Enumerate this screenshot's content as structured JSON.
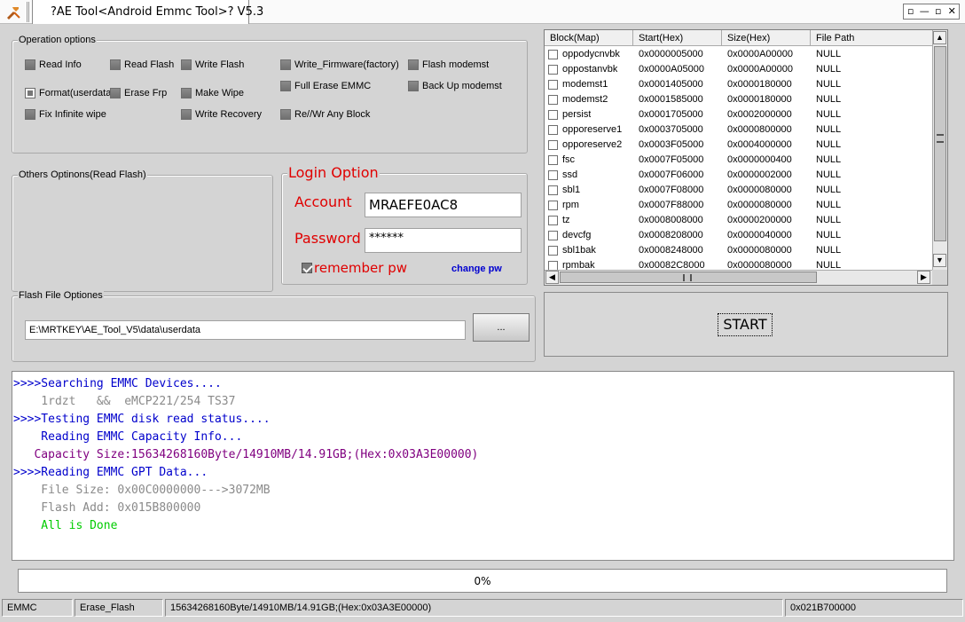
{
  "window": {
    "title": "?AE Tool<Android Emmc Tool>? V5.3",
    "controls": [
      "▫",
      "—",
      "▫",
      "✕"
    ]
  },
  "operation": {
    "title": "Operation options",
    "items": [
      {
        "label": "Read Info",
        "state": "off"
      },
      {
        "label": "Read Flash",
        "state": "off"
      },
      {
        "label": "Write Flash",
        "state": "off"
      },
      {
        "label": "Write_Firmware(factory)",
        "state": "off"
      },
      {
        "label": "Flash modemst",
        "state": "off"
      },
      {
        "label": "Format(userdata)",
        "state": "selected"
      },
      {
        "label": "Erase Frp",
        "state": "off"
      },
      {
        "label": "Make Wipe",
        "state": "off"
      },
      {
        "label": "Full Erase EMMC",
        "state": "off"
      },
      {
        "label": "Back Up modemst",
        "state": "off"
      },
      {
        "label": "Fix Infinite wipe",
        "state": "off"
      },
      {
        "label": "Write Recovery",
        "state": "off"
      },
      {
        "label": "Re//Wr Any Block",
        "state": "off"
      }
    ]
  },
  "others": {
    "title": "Others Optinons(Read Flash)"
  },
  "login": {
    "title": "Login Option",
    "account_label": "Account",
    "account_value": "MRAEFE0AC8",
    "password_label": "Password",
    "password_value": "******",
    "remember_label": "remember pw",
    "remember_checked": true,
    "change_label": "change pw"
  },
  "flash": {
    "title": "Flash File Optiones",
    "path": "E:\\MRTKEY\\AE_Tool_V5\\data\\userdata",
    "browse_label": "..."
  },
  "blocks": {
    "columns": [
      "Block(Map)",
      "Start(Hex)",
      "Size(Hex)",
      "File Path"
    ],
    "rows": [
      [
        "oppodycnvbk",
        "0x0000005000",
        "0x0000A00000",
        "NULL"
      ],
      [
        "oppostanvbk",
        "0x0000A05000",
        "0x0000A00000",
        "NULL"
      ],
      [
        "modemst1",
        "0x0001405000",
        "0x0000180000",
        "NULL"
      ],
      [
        "modemst2",
        "0x0001585000",
        "0x0000180000",
        "NULL"
      ],
      [
        "persist",
        "0x0001705000",
        "0x0002000000",
        "NULL"
      ],
      [
        "opporeserve1",
        "0x0003705000",
        "0x0000800000",
        "NULL"
      ],
      [
        "opporeserve2",
        "0x0003F05000",
        "0x0004000000",
        "NULL"
      ],
      [
        "fsc",
        "0x0007F05000",
        "0x0000000400",
        "NULL"
      ],
      [
        "ssd",
        "0x0007F06000",
        "0x0000002000",
        "NULL"
      ],
      [
        "sbl1",
        "0x0007F08000",
        "0x0000080000",
        "NULL"
      ],
      [
        "rpm",
        "0x0007F88000",
        "0x0000080000",
        "NULL"
      ],
      [
        "tz",
        "0x0008008000",
        "0x0000200000",
        "NULL"
      ],
      [
        "devcfg",
        "0x0008208000",
        "0x0000040000",
        "NULL"
      ],
      [
        "sbl1bak",
        "0x0008248000",
        "0x0000080000",
        "NULL"
      ],
      [
        "rpmbak",
        "0x00082C8000",
        "0x0000080000",
        "NULL"
      ]
    ]
  },
  "start_label": "START",
  "log": [
    {
      "text": ">>>>Searching EMMC Devices....",
      "color": "#0000cc"
    },
    {
      "text": "    1rdzt   &&  eMCP221/254 TS37",
      "color": "#8a8a8a"
    },
    {
      "text": ">>>>Testing EMMC disk read status....",
      "color": "#0000cc"
    },
    {
      "text": "    Reading EMMC Capacity Info...",
      "color": "#0000cc"
    },
    {
      "text": "   Capacity Size:15634268160Byte/14910MB/14.91GB;(Hex:0x03A3E00000)",
      "color": "#800080"
    },
    {
      "text": ">>>>Reading EMMC GPT Data...",
      "color": "#0000cc"
    },
    {
      "text": "    File Size: 0x00C0000000--->3072MB",
      "color": "#8a8a8a"
    },
    {
      "text": "    Flash Add: 0x015B800000",
      "color": "#8a8a8a"
    },
    {
      "text": "    All is Done",
      "color": "#00cc00"
    }
  ],
  "progress": {
    "text": "0%",
    "value": 0
  },
  "status": {
    "mode": "EMMC",
    "action": "Erase_Flash",
    "capacity": "15634268160Byte/14910MB/14.91GB;(Hex:0x03A3E00000)",
    "address": "0x021B700000"
  }
}
